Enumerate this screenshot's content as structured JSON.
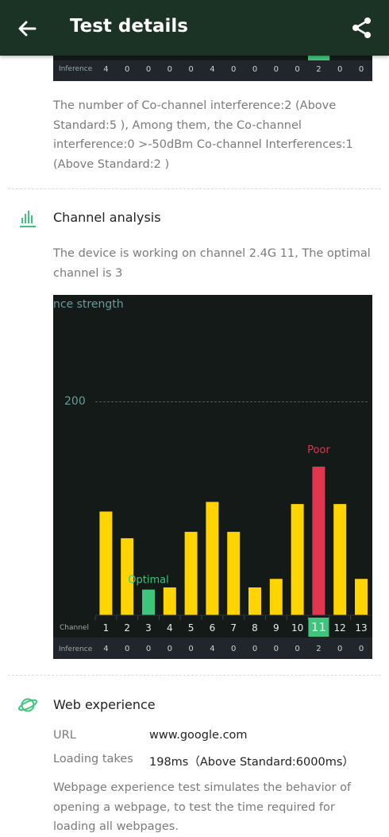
{
  "appbar": {
    "title": "Test details",
    "back_icon": "arrow-left-icon",
    "share_icon": "share-icon"
  },
  "top_chart": {
    "inference_label": "Inference",
    "inference_values": [
      "4",
      "0",
      "0",
      "0",
      "0",
      "4",
      "0",
      "0",
      "0",
      "0",
      "2",
      "0",
      "0"
    ]
  },
  "interference_summary": "The number of Co-channel interference:2 (Above Standard:5 ), Among them, the Co-channel interference:0 >-50dBm Co-channel Interferences:1 (Above Standard:2 )",
  "channel_analysis": {
    "icon": "bar-chart-icon",
    "title": "Channel analysis",
    "description": "The device is working on channel 2.4G 11, The optimal channel is 3"
  },
  "chart_data": {
    "type": "bar",
    "title": "nce strength",
    "y_tick": "200",
    "categories": [
      "1",
      "2",
      "3",
      "4",
      "5",
      "6",
      "7",
      "8",
      "9",
      "10",
      "11",
      "12",
      "13"
    ],
    "values": [
      97,
      72,
      24,
      26,
      78,
      106,
      78,
      26,
      34,
      104,
      139,
      104,
      34
    ],
    "x_row_label": "Channel",
    "inference_label": "Inference",
    "inference_values": [
      "4",
      "0",
      "0",
      "0",
      "0",
      "4",
      "0",
      "0",
      "0",
      "0",
      "2",
      "0",
      "0"
    ],
    "optimal_label": "Optimal",
    "optimal_index": 2,
    "poor_label": "Poor",
    "poor_index": 10,
    "colors": {
      "bar": "#ffd400",
      "optimal": "#3fc47c",
      "poor": "#e0364f",
      "background": "#141a18",
      "row": "#20262b"
    }
  },
  "web_experience": {
    "icon": "planet-icon",
    "title": "Web experience",
    "url_label": "URL",
    "url_value": "www.google.com",
    "loading_label": "Loading takes",
    "loading_value": "198ms（Above Standard:6000ms）",
    "description": "Webpage experience test simulates the behavior of opening a webpage, to test the time required for loading all webpages."
  }
}
